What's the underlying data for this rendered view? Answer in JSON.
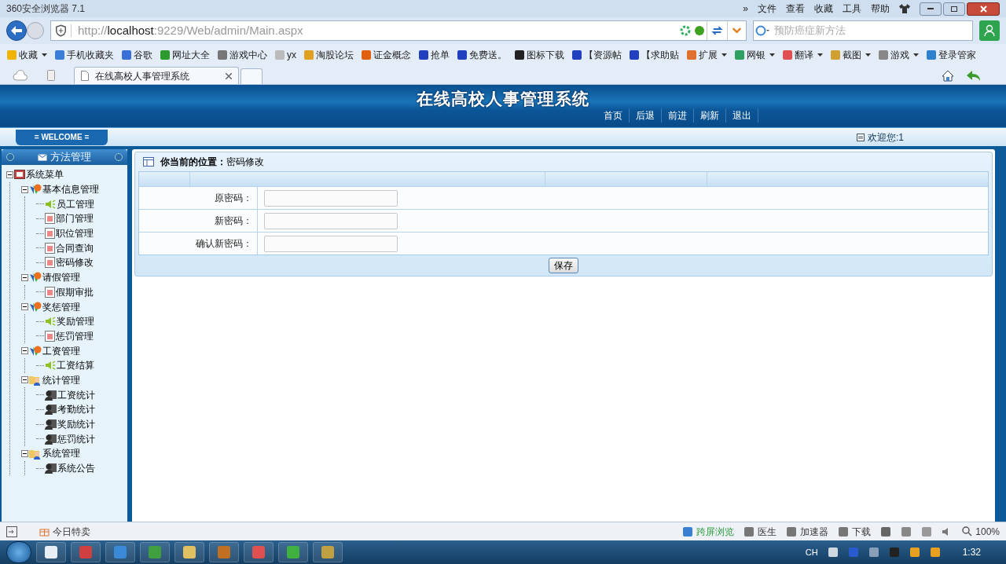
{
  "browser": {
    "title": "360安全浏览器 7.1",
    "menu": [
      "»",
      "文件",
      "查看",
      "收藏",
      "工具",
      "帮助"
    ],
    "address": {
      "scheme": "http://",
      "host": "localhost",
      "rest": ":9229/Web/admin/Main.aspx"
    },
    "search": {
      "placeholder": "预防癌症新方法"
    },
    "bookmarks": [
      {
        "label": "收藏",
        "color": "#f0b400",
        "menu": true
      },
      {
        "label": "手机收藏夹",
        "color": "#3a7fd5",
        "menu": false
      },
      {
        "label": "谷歌",
        "color": "#3b6fd8",
        "menu": false
      },
      {
        "label": "网址大全",
        "color": "#2c9a2c",
        "menu": false
      },
      {
        "label": "游戏中心",
        "color": "#777777",
        "menu": false
      },
      {
        "label": "yx",
        "color": "#bbbbbb",
        "menu": false
      },
      {
        "label": "淘股论坛",
        "color": "#e0a020",
        "menu": false
      },
      {
        "label": "证金概念",
        "color": "#e06010",
        "menu": false
      },
      {
        "label": "抢单",
        "color": "#2040c0",
        "menu": false
      },
      {
        "label": "免费送。",
        "color": "#2040c0",
        "menu": false
      },
      {
        "label": "图标下载",
        "color": "#222222",
        "menu": false
      },
      {
        "label": "【资源帖",
        "color": "#2040c0",
        "menu": false
      },
      {
        "label": "【求助贴",
        "color": "#2040c0",
        "menu": false
      },
      {
        "label": "扩展",
        "color": "#e07030",
        "menu": true
      },
      {
        "label": "网银",
        "color": "#30a060",
        "menu": true
      },
      {
        "label": "翻译",
        "color": "#e05050",
        "menu": true
      },
      {
        "label": "截图",
        "color": "#d0a030",
        "menu": true
      },
      {
        "label": "游戏",
        "color": "#888888",
        "menu": true
      },
      {
        "label": "登录管家",
        "color": "#3080d0",
        "menu": false
      }
    ],
    "tabs": [
      {
        "label": "在线高校人事管理系统",
        "selected": true
      }
    ]
  },
  "app": {
    "title": "在线高校人事管理系统",
    "nav": [
      "首页",
      "后退",
      "前进",
      "刷新",
      "退出"
    ],
    "welcome_badge": "= WELCOME =",
    "greeting": "欢迎您:1",
    "sidebar": {
      "title": "方法管理",
      "tree": [
        {
          "label": "系统菜单",
          "kind": "root",
          "expanded": true,
          "children": [
            {
              "label": "基本信息管理",
              "kind": "group",
              "expanded": true,
              "children": [
                {
                  "label": "员工管理",
                  "kind": "sound"
                },
                {
                  "label": "部门管理",
                  "kind": "page"
                },
                {
                  "label": "职位管理",
                  "kind": "page"
                },
                {
                  "label": "合同查询",
                  "kind": "page"
                },
                {
                  "label": "密码修改",
                  "kind": "page"
                }
              ]
            },
            {
              "label": "请假管理",
              "kind": "group",
              "expanded": true,
              "children": [
                {
                  "label": "假期审批",
                  "kind": "page"
                }
              ]
            },
            {
              "label": "奖惩管理",
              "kind": "group",
              "expanded": true,
              "children": [
                {
                  "label": "奖励管理",
                  "kind": "sound"
                },
                {
                  "label": "惩罚管理",
                  "kind": "page"
                }
              ]
            },
            {
              "label": "工资管理",
              "kind": "group",
              "expanded": true,
              "children": [
                {
                  "label": "工资结算",
                  "kind": "sound"
                }
              ]
            },
            {
              "label": "统计管理",
              "kind": "folder",
              "expanded": true,
              "children": [
                {
                  "label": "工资统计",
                  "kind": "person"
                },
                {
                  "label": "考勤统计",
                  "kind": "person"
                },
                {
                  "label": "奖励统计",
                  "kind": "person"
                },
                {
                  "label": "惩罚统计",
                  "kind": "person"
                }
              ]
            },
            {
              "label": "系统管理",
              "kind": "folder",
              "expanded": true,
              "children": [
                {
                  "label": "系统公告",
                  "kind": "person"
                }
              ]
            }
          ]
        }
      ]
    },
    "breadcrumb": "**你当前的位置：**密码修改",
    "form": [
      {
        "label": "原密码："
      },
      {
        "label": "新密码："
      },
      {
        "label": "确认新密码："
      }
    ],
    "save_button": "保存"
  },
  "status_bar": {
    "left": "今日特卖",
    "items": [
      "跨屏浏览",
      "医生",
      "加速器",
      "下载"
    ],
    "zoom": "100%"
  },
  "taskbar": {
    "lang": "CH",
    "time": "1:32"
  }
}
